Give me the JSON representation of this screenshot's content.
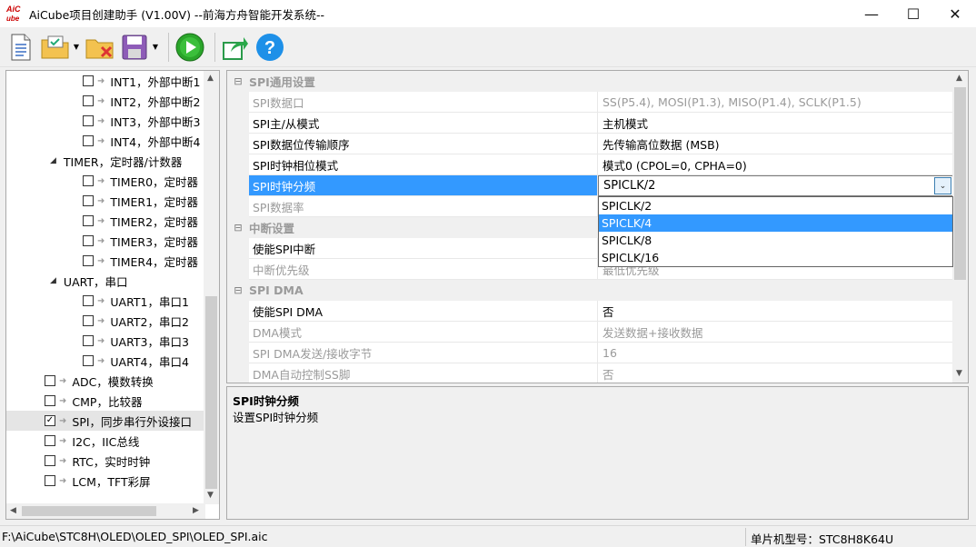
{
  "window": {
    "title": "AiCube项目创建助手 (V1.00V) --前海方舟智能开发系统--",
    "logo_text": "AiCube",
    "colors": {
      "selection": "#3399ff",
      "category_bg": "#f0f0f0",
      "disabled_text": "#9a9a9a"
    }
  },
  "toolbar": {
    "buttons": [
      "new-file-icon",
      "open-project-icon",
      "close-project-icon",
      "save-icon",
      "run-icon",
      "export-icon",
      "help-icon"
    ]
  },
  "tree": {
    "items": [
      {
        "label": "INT1，外部中断1",
        "level": 2,
        "checked": false
      },
      {
        "label": "INT2，外部中断2",
        "level": 2,
        "checked": false
      },
      {
        "label": "INT3，外部中断3",
        "level": 2,
        "checked": false
      },
      {
        "label": "INT4，外部中断4",
        "level": 2,
        "checked": false
      },
      {
        "label": "TIMER，定时器/计数器",
        "level": 1,
        "group": true
      },
      {
        "label": "TIMER0，定时器",
        "level": 2,
        "checked": false
      },
      {
        "label": "TIMER1，定时器",
        "level": 2,
        "checked": false
      },
      {
        "label": "TIMER2，定时器",
        "level": 2,
        "checked": false
      },
      {
        "label": "TIMER3，定时器",
        "level": 2,
        "checked": false
      },
      {
        "label": "TIMER4，定时器",
        "level": 2,
        "checked": false
      },
      {
        "label": "UART，串口",
        "level": 1,
        "group": true
      },
      {
        "label": "UART1，串口1",
        "level": 2,
        "checked": false
      },
      {
        "label": "UART2，串口2",
        "level": 2,
        "checked": false
      },
      {
        "label": "UART3，串口3",
        "level": 2,
        "checked": false
      },
      {
        "label": "UART4，串口4",
        "level": 2,
        "checked": false
      },
      {
        "label": "ADC，模数转换",
        "level": 0,
        "checked": false
      },
      {
        "label": "CMP，比较器",
        "level": 0,
        "checked": false
      },
      {
        "label": "SPI，同步串行外设接口",
        "level": 0,
        "checked": true,
        "selected": true
      },
      {
        "label": "I2C，IIC总线",
        "level": 0,
        "checked": false
      },
      {
        "label": "RTC，实时时钟",
        "level": 0,
        "checked": false
      },
      {
        "label": "LCM，TFT彩屏",
        "level": 0,
        "checked": false
      }
    ]
  },
  "props": {
    "rows": [
      {
        "kind": "cat",
        "name": "SPI通用设置"
      },
      {
        "kind": "row",
        "name": "SPI数据口",
        "value": "SS(P5.4), MOSI(P1.3), MISO(P1.4), SCLK(P1.5)",
        "disabled": true
      },
      {
        "kind": "row",
        "name": "SPI主/从模式",
        "value": "主机模式",
        "disabled": false
      },
      {
        "kind": "row",
        "name": "SPI数据位传输顺序",
        "value": "先传输高位数据 (MSB)",
        "disabled": false
      },
      {
        "kind": "row",
        "name": "SPI时钟相位模式",
        "value": "模式0 (CPOL=0, CPHA=0)",
        "disabled": false
      },
      {
        "kind": "row",
        "name": "SPI时钟分频",
        "value": "SPICLK/2",
        "disabled": false,
        "selected": true
      },
      {
        "kind": "row",
        "name": "SPI数据率",
        "value": "",
        "disabled": true
      },
      {
        "kind": "cat",
        "name": "中断设置"
      },
      {
        "kind": "row",
        "name": "使能SPI中断",
        "value": "",
        "disabled": false
      },
      {
        "kind": "row",
        "name": "中断优先级",
        "value": "最低优先级",
        "disabled": true
      },
      {
        "kind": "cat",
        "name": "SPI DMA"
      },
      {
        "kind": "row",
        "name": "使能SPI DMA",
        "value": "否",
        "disabled": false
      },
      {
        "kind": "row",
        "name": "DMA模式",
        "value": "发送数据+接收数据",
        "disabled": true
      },
      {
        "kind": "row",
        "name": "SPI DMA发送/接收字节",
        "value": "16",
        "disabled": true
      },
      {
        "kind": "row",
        "name": "DMA自动控制SS脚",
        "value": "否",
        "disabled": true
      }
    ],
    "combo_value": "SPICLK/2",
    "dropdown_options": [
      "SPICLK/2",
      "SPICLK/4",
      "SPICLK/8",
      "SPICLK/16"
    ],
    "dropdown_highlighted": "SPICLK/4"
  },
  "description": {
    "title": "SPI时钟分频",
    "text": "设置SPI时钟分频"
  },
  "status": {
    "path": "F:\\AiCube\\STC8H\\OLED\\OLED_SPI\\OLED_SPI.aic",
    "chip": "单片机型号：STC8H8K64U"
  }
}
